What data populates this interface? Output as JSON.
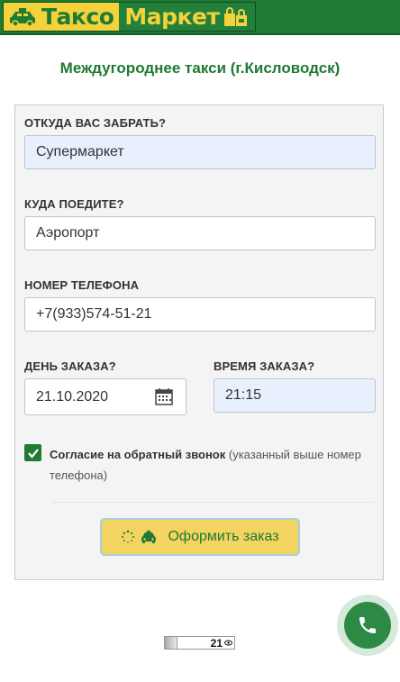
{
  "header": {
    "logo_left": "Таксо",
    "logo_right": "Маркет"
  },
  "page_title": "Междугороднее такси (г.Кисловодск)",
  "form": {
    "from": {
      "label": "ОТКУДА ВАС ЗАБРАТЬ?",
      "value": "Супермаркет"
    },
    "to": {
      "label": "КУДА ПОЕДИТЕ?",
      "value": "Аэропорт"
    },
    "phone": {
      "label": "НОМЕР ТЕЛЕФОНА",
      "value": "+7(933)574-51-21"
    },
    "date": {
      "label": "ДЕНЬ ЗАКАЗА?",
      "value": "21.10.2020"
    },
    "time": {
      "label": "ВРЕМЯ ЗАКАЗА?",
      "value": "21:15"
    },
    "consent": {
      "checked": true,
      "bold": "Согласие на обратный звонок",
      "rest": " (указанный выше номер телефона)"
    },
    "submit_label": "Оформить заказ"
  },
  "counter": {
    "value": "21"
  },
  "colors": {
    "brand_green": "#1f7a33",
    "brand_yellow": "#f4d23c",
    "button_yellow": "#f4d460",
    "autofill_blue": "#e8f0fe"
  }
}
